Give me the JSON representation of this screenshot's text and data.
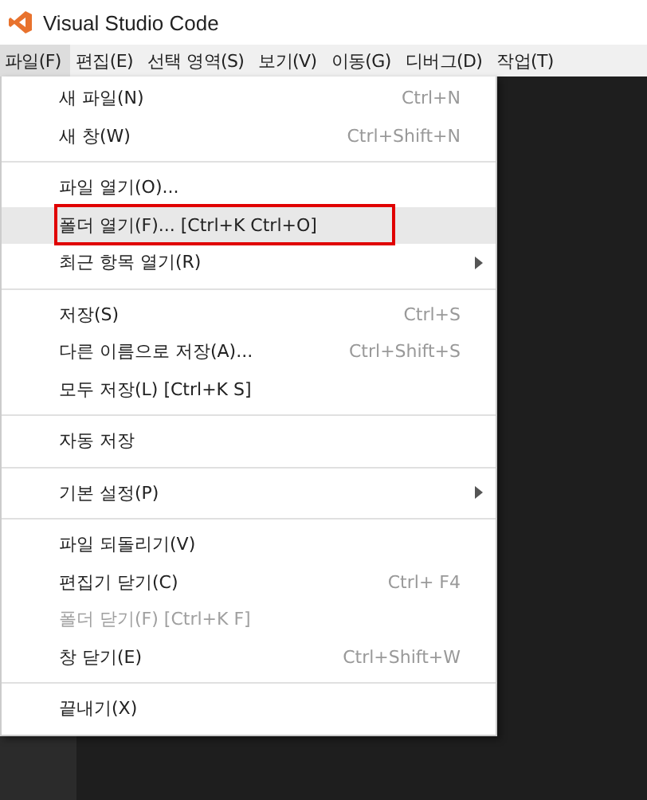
{
  "window": {
    "title": "Visual Studio Code"
  },
  "menubar": [
    {
      "label": "파일(F)",
      "selected": true
    },
    {
      "label": "편집(E)",
      "selected": false
    },
    {
      "label": "선택 영역(S)",
      "selected": false
    },
    {
      "label": "보기(V)",
      "selected": false
    },
    {
      "label": "이동(G)",
      "selected": false
    },
    {
      "label": "디버그(D)",
      "selected": false
    },
    {
      "label": "작업(T)",
      "selected": false
    }
  ],
  "menu": [
    {
      "kind": "item",
      "label": "새 파일(N)",
      "shortcut": "Ctrl+N"
    },
    {
      "kind": "item",
      "label": "새 창(W)",
      "shortcut": "Ctrl+Shift+N"
    },
    {
      "kind": "separator"
    },
    {
      "kind": "item",
      "label": "파일 열기(O)..."
    },
    {
      "kind": "item",
      "label": "폴더 열기(F)... [Ctrl+K Ctrl+O]",
      "selected": true,
      "annotated": true
    },
    {
      "kind": "submenu",
      "label": "최근 항목 열기(R)"
    },
    {
      "kind": "separator"
    },
    {
      "kind": "item",
      "label": "저장(S)",
      "shortcut": "Ctrl+S"
    },
    {
      "kind": "item",
      "label": "다른 이름으로 저장(A)...",
      "shortcut": "Ctrl+Shift+S"
    },
    {
      "kind": "item",
      "label": "모두 저장(L) [Ctrl+K S]"
    },
    {
      "kind": "separator"
    },
    {
      "kind": "item",
      "label": "자동 저장"
    },
    {
      "kind": "separator"
    },
    {
      "kind": "submenu",
      "label": "기본 설정(P)"
    },
    {
      "kind": "separator"
    },
    {
      "kind": "item",
      "label": "파일 되돌리기(V)"
    },
    {
      "kind": "item",
      "label": "편집기 닫기(C)",
      "shortcut": "Ctrl+  F4"
    },
    {
      "kind": "item",
      "label": "폴더 닫기(F) [Ctrl+K F]",
      "disabled": true
    },
    {
      "kind": "item",
      "label": "창 닫기(E)",
      "shortcut": "Ctrl+Shift+W"
    },
    {
      "kind": "separator"
    },
    {
      "kind": "item",
      "label": "끝내기(X)"
    }
  ]
}
